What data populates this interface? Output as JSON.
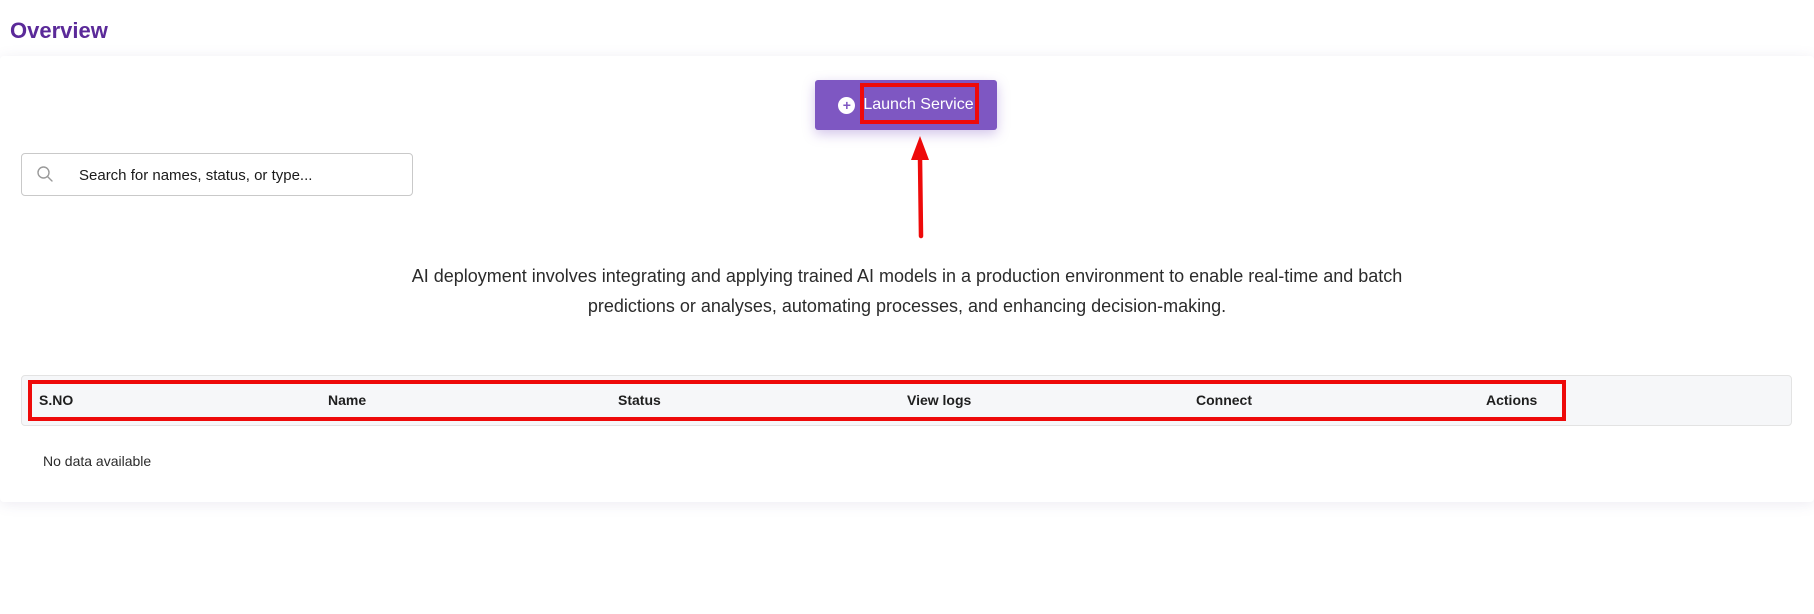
{
  "header": {
    "title": "Overview"
  },
  "toolbar": {
    "launch_label": "Launch Service",
    "launch_icon": "plus-circle-icon"
  },
  "search": {
    "placeholder": "Search for names, status, or type...",
    "value": "",
    "icon": "search-icon"
  },
  "main": {
    "description": "AI deployment involves integrating and applying trained AI models in a production environment to enable real-time and batch predictions or analyses, automating processes, and enhancing decision-making."
  },
  "table": {
    "columns": [
      "S.NO",
      "Name",
      "Status",
      "View logs",
      "Connect",
      "Actions"
    ],
    "rows": [],
    "empty_message": "No data available"
  },
  "colors": {
    "accent": "#7e57c2",
    "title": "#5b2a99",
    "annotation": "#ee0a0a"
  }
}
